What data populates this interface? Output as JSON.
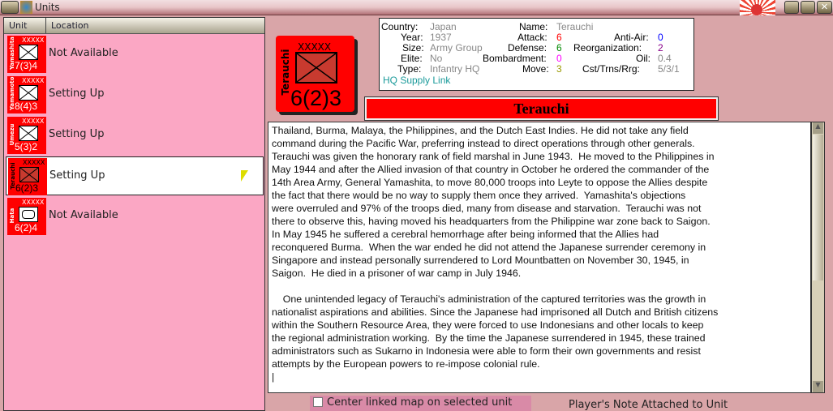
{
  "window": {
    "title": "Units"
  },
  "columns": [
    "Unit",
    "Location"
  ],
  "units": [
    {
      "name": "Yamashita",
      "size": "XXXXX",
      "strength": "7(3)4",
      "location": "Not Available",
      "symbol": "infantry"
    },
    {
      "name": "Yamamoto",
      "size": "XXXXX",
      "strength": "8(4)3",
      "location": "Setting Up",
      "symbol": "infantry"
    },
    {
      "name": "Umezu",
      "size": "XXXXX",
      "strength": "5(3)2",
      "location": "Setting Up",
      "symbol": "infantry"
    },
    {
      "name": "Terauchi",
      "size": "XXXXX",
      "strength": "6(2)3",
      "location": "Setting Up",
      "symbol": "infantry-hq"
    },
    {
      "name": "Hata",
      "size": "XXXXX",
      "strength": "6(2)4",
      "location": "Not Available",
      "symbol": "armor"
    }
  ],
  "selected": {
    "name": "Terauchi",
    "size": "XXXXX",
    "strength": "6(2)3"
  },
  "info": {
    "country_k": "Country:",
    "country": "Japan",
    "year_k": "Year:",
    "year": "1937",
    "size_k": "Size:",
    "size": "Army Group",
    "elite_k": "Elite:",
    "elite": "No",
    "type_k": "Type:",
    "type": "Infantry HQ",
    "link": "HQ Supply Link",
    "name_k": "Name:",
    "name": "Terauchi",
    "attack_k": "Attack:",
    "attack": "6",
    "defense_k": "Defense:",
    "defense": "6",
    "bomb_k": "Bombardment:",
    "bomb": "0",
    "move_k": "Move:",
    "move": "3",
    "aa_k": "Anti-Air:",
    "aa": "0",
    "reorg_k": "Reorganization:",
    "reorg": "2",
    "oil_k": "Oil:",
    "oil": "0.4",
    "cst_k": "Cst/Trns/Rrg:",
    "cst": "5/3/1"
  },
  "biography": "Thailand, Burma, Malaya, the Philippines, and the Dutch East Indies. He did not take any field\ncommand during the Pacific War, preferring instead to direct operations through other generals.\nTerauchi was given the honorary rank of field marshal in June 1943.  He moved to the Philippines in\nMay 1944 and after the Allied invasion of that country in October he ordered the commander of the\n14th Area Army, General Yamashita, to move 80,000 troops into Leyte to oppose the Allies despite\nthe fact that there would be no way to supply them once they arrived.  Yamashita's objections\nwere overruled and 97% of the troops died, many from disease and starvation.  Terauchi was not\nthere to observe this, having moved his headquarters from the Philippine war zone back to Saigon.\nIn May 1945 he suffered a cerebral hemorrhage after being informed that the Allies had\nreconquered Burma.  When the war ended he did not attend the Japanese surrender ceremony in\nSingapore and instead personally surrendered to Lord Mountbatten on November 30, 1945, in\nSaigon.  He died in a prisoner of war camp in July 1946.\n\n    One unintended legacy of Terauchi's administration of the captured territories was the growth in\nnationalist aspirations and abilities. Since the Japanese had imprisoned all Dutch and British citizens\nwithin the Southern Resource Area, they were forced to use Indonesians and other locals to keep\nthe regional administration working.  By the time the Japanese surrendered in 1945, these trained\nadministrators such as Sukarno in Indonesia were able to form their own governments and resist\nattempts by the European powers to re-impose colonial rule.\n|",
  "center_checkbox": {
    "label": "Center linked map on selected unit",
    "checked": false
  },
  "note_label": "Player's Note Attached to Unit"
}
